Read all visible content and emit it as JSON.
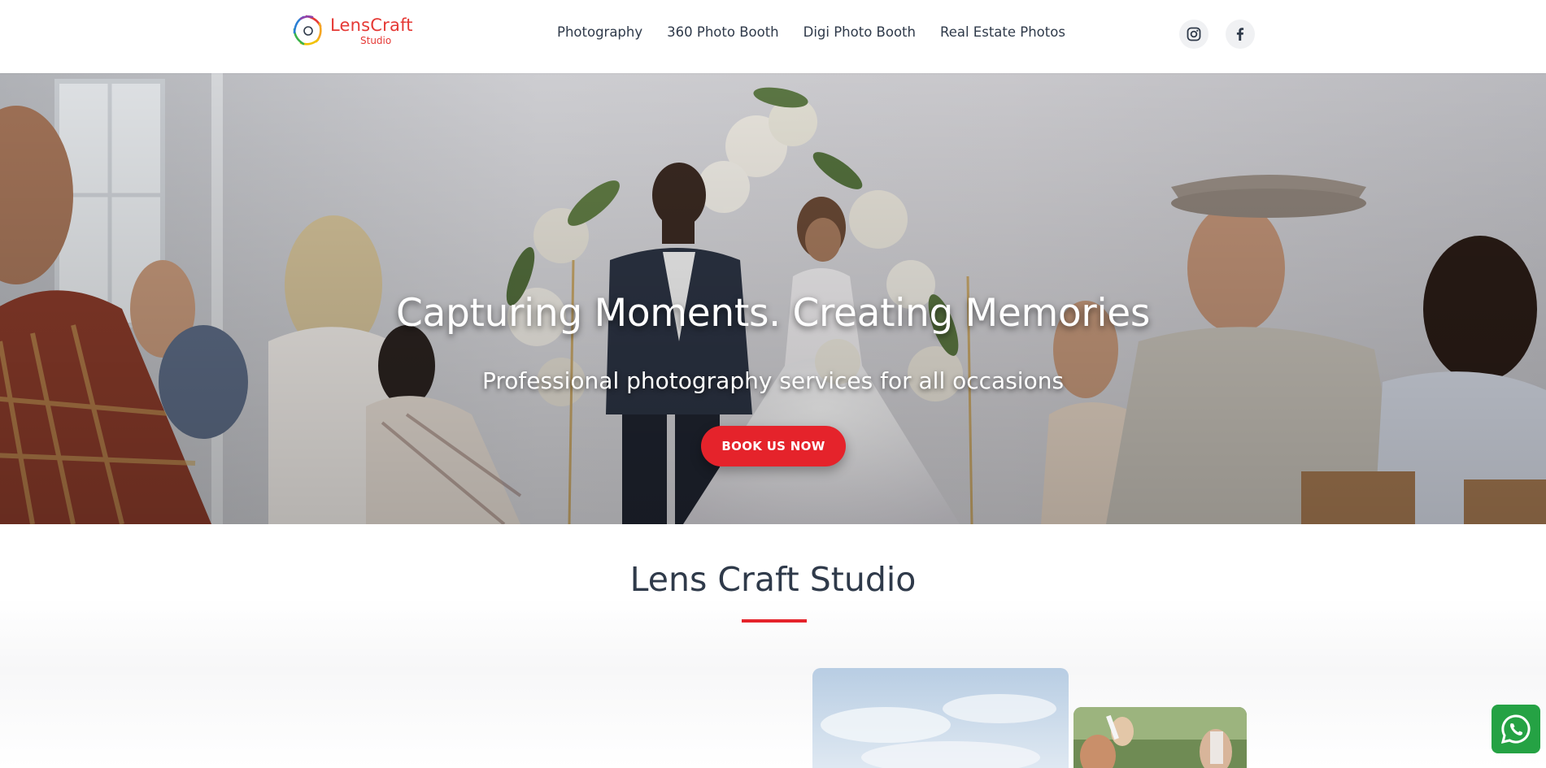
{
  "brand": {
    "name": "LensCraft",
    "sub": "Studio",
    "color": "#e53935"
  },
  "nav": {
    "items": [
      {
        "label": "Photography"
      },
      {
        "label": "360 Photo Booth"
      },
      {
        "label": "Digi Photo Booth"
      },
      {
        "label": "Real Estate Photos"
      }
    ]
  },
  "social": {
    "instagram_icon": "instagram-icon",
    "facebook_icon": "facebook-icon"
  },
  "hero": {
    "title": "Capturing Moments. Creating Memories",
    "subtitle": "Professional photography services for all occasions",
    "cta": "BOOK US NOW",
    "accent": "#e5232b"
  },
  "about": {
    "title": "Lens Craft Studio"
  },
  "whatsapp": {
    "icon": "whatsapp-icon",
    "color": "#25a244"
  }
}
